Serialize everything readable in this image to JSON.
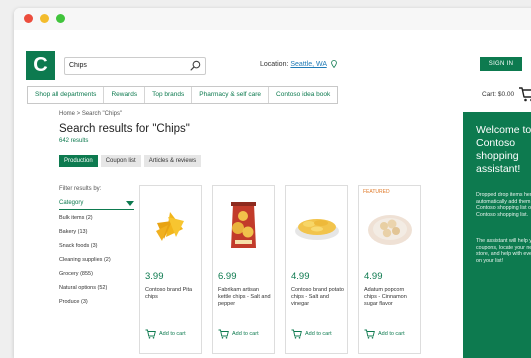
{
  "header": {
    "logo_letter": "C",
    "search": {
      "value": "Chips",
      "placeholder": ""
    },
    "location_label": "Location:",
    "location_city": "Seattle, WA",
    "signin_label": "SIGN IN",
    "cart_label": "Cart: $0.00"
  },
  "nav": {
    "items": [
      {
        "label": "Shop all departments"
      },
      {
        "label": "Rewards"
      },
      {
        "label": "Top brands"
      },
      {
        "label": "Pharmacy & self care"
      },
      {
        "label": "Contoso idea book"
      }
    ]
  },
  "main": {
    "breadcrumb": "Home > Search \"Chips\"",
    "title": "Search results for \"Chips\"",
    "result_count": "642 results",
    "tabs": [
      {
        "label": "Production"
      },
      {
        "label": "Coupon list"
      },
      {
        "label": "Articles & reviews"
      }
    ]
  },
  "filters": {
    "heading": "Filter results by:",
    "category": "Category",
    "options": [
      {
        "label": "Bulk items (2)"
      },
      {
        "label": "Bakery (13)"
      },
      {
        "label": "Snack foods (3)"
      },
      {
        "label": "Cleaning supplies (2)"
      },
      {
        "label": "Grocery (855)"
      },
      {
        "label": "Natural options (52)"
      },
      {
        "label": "Produce (3)"
      }
    ]
  },
  "products": [
    {
      "price": "3.99",
      "name": "Contoso brand Pita chips",
      "add_label": "Add to cart",
      "featured": ""
    },
    {
      "price": "6.99",
      "name": "Fabrikam artisan kettle chips - Salt and pepper",
      "add_label": "Add to cart",
      "featured": ""
    },
    {
      "price": "4.99",
      "name": "Contoso brand potato chips - Salt and vinegar",
      "add_label": "Add to cart",
      "featured": ""
    },
    {
      "price": "4.99",
      "name": "Adatum popcorn chips - Cinnamon sugar flavor",
      "add_label": "Add to cart",
      "featured": "FEATURED"
    }
  ],
  "assistant": {
    "heading": "Welcome to the Contoso shopping assistant!",
    "p1": "Dropped drop items here to automatically add them to your Contoso shopping list or Contoso shopping list.",
    "p2": "The assistant will help you find coupons, locate your nearest store, and help with everything on your list!"
  },
  "colors": {
    "brand": "#0d7a4f",
    "featured": "#e07a2a"
  },
  "icons": {
    "search": "search-icon",
    "location": "pin-icon",
    "cart": "cart-icon",
    "add_to_cart": "cart-icon"
  }
}
